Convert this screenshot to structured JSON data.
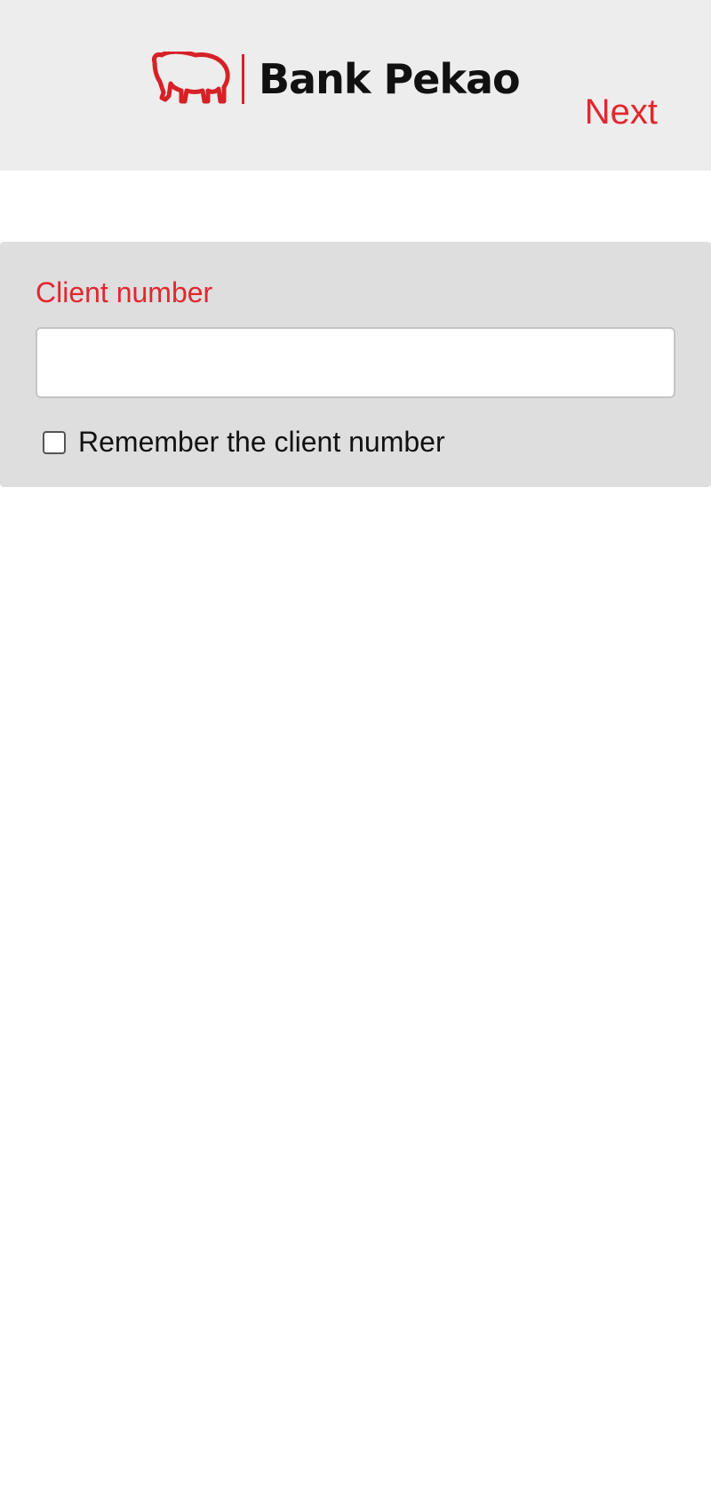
{
  "header": {
    "logo_text": "Bank Pekao",
    "next_label": "Next"
  },
  "login": {
    "client_number_label": "Client number",
    "client_number_value": "",
    "remember_label": "Remember the client number",
    "remember_checked": false
  },
  "colors": {
    "accent": "#e0282e",
    "header_bg": "#ededed",
    "panel_bg": "#dedede"
  },
  "icons": {
    "logo": "bison-icon"
  }
}
